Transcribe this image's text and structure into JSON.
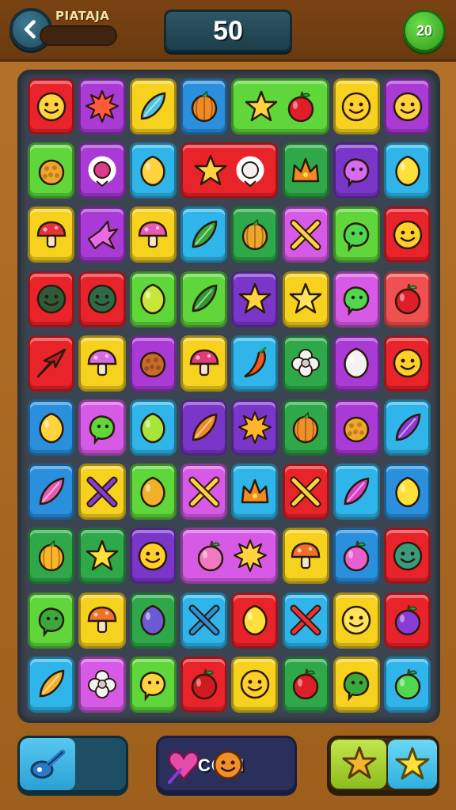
{
  "header": {
    "level_name": "PIATAJA",
    "score": "50",
    "moves": "20"
  },
  "board": {
    "rows": 10,
    "cols": 8,
    "tiles": [
      {
        "r": 0,
        "c": 0,
        "span": 1,
        "color": "#e8232a",
        "icon": "smiley-icon",
        "glyph": "face",
        "gc": "#ffd23f"
      },
      {
        "r": 0,
        "c": 1,
        "span": 1,
        "color": "#a93ad6",
        "icon": "sun-icon",
        "glyph": "sun",
        "gc": "#ff5a3c"
      },
      {
        "r": 0,
        "c": 2,
        "span": 1,
        "color": "#f6d21e",
        "icon": "crystal-icon",
        "glyph": "leaf",
        "gc": "#4fc3e0"
      },
      {
        "r": 0,
        "c": 3,
        "span": 1,
        "color": "#2a8fdd",
        "icon": "pumpkin-icon",
        "glyph": "orange",
        "gc": "#f08a24"
      },
      {
        "r": 0,
        "c": 4,
        "span": 2,
        "color": "#5fd63a",
        "icon": "star-apple-icon",
        "glyph": "starapple",
        "gc": "#ffd23f"
      },
      {
        "r": 0,
        "c": 6,
        "span": 1,
        "color": "#f6d21e",
        "icon": "smiley-icon",
        "glyph": "face",
        "gc": "#ffcf2a"
      },
      {
        "r": 0,
        "c": 7,
        "span": 1,
        "color": "#a93ad6",
        "icon": "smiley-icon",
        "glyph": "face",
        "gc": "#ffd23f"
      },
      {
        "r": 1,
        "c": 0,
        "span": 1,
        "color": "#5fd63a",
        "icon": "pineapple-icon",
        "glyph": "berry",
        "gc": "#f0a62a"
      },
      {
        "r": 1,
        "c": 1,
        "span": 1,
        "color": "#a93ad6",
        "icon": "candy-icon",
        "glyph": "ring",
        "gc": "#e03a8a"
      },
      {
        "r": 1,
        "c": 2,
        "span": 1,
        "color": "#2fb5ea",
        "icon": "lemon-icon",
        "glyph": "lemon",
        "gc": "#ffd23f"
      },
      {
        "r": 1,
        "c": 3,
        "span": 2,
        "color": "#e8232a",
        "icon": "star-lollipop-icon",
        "glyph": "starlolly",
        "gc": "#ffd23f"
      },
      {
        "r": 1,
        "c": 5,
        "span": 1,
        "color": "#2fa84a",
        "icon": "crown-icon",
        "glyph": "crown",
        "gc": "#f08a24"
      },
      {
        "r": 1,
        "c": 6,
        "span": 1,
        "color": "#7a36c8",
        "icon": "blob-icon",
        "glyph": "blob",
        "gc": "#d66af0"
      },
      {
        "r": 1,
        "c": 7,
        "span": 1,
        "color": "#2fb5ea",
        "icon": "lemon-icon",
        "glyph": "lemon",
        "gc": "#ffe03a"
      },
      {
        "r": 2,
        "c": 0,
        "span": 1,
        "color": "#f6d21e",
        "icon": "mushroom-icon",
        "glyph": "mushroom",
        "gc": "#e8323a"
      },
      {
        "r": 2,
        "c": 1,
        "span": 1,
        "color": "#a93ad6",
        "icon": "bird-icon",
        "glyph": "bird",
        "gc": "#e86ae8"
      },
      {
        "r": 2,
        "c": 2,
        "span": 1,
        "color": "#f6d21e",
        "icon": "mushroom-icon",
        "glyph": "mushroom",
        "gc": "#e85ab0"
      },
      {
        "r": 2,
        "c": 3,
        "span": 1,
        "color": "#2fb5ea",
        "icon": "pepper-icon",
        "glyph": "leaf",
        "gc": "#3aa83a"
      },
      {
        "r": 2,
        "c": 4,
        "span": 1,
        "color": "#2fa84a",
        "icon": "onion-icon",
        "glyph": "orange",
        "gc": "#f0a62a"
      },
      {
        "r": 2,
        "c": 5,
        "span": 1,
        "color": "#d65ae6",
        "icon": "sword-icon",
        "glyph": "cross",
        "gc": "#ffd23f"
      },
      {
        "r": 2,
        "c": 6,
        "span": 1,
        "color": "#5fd63a",
        "icon": "blob-icon",
        "glyph": "blob",
        "gc": "#4fd84f"
      },
      {
        "r": 2,
        "c": 7,
        "span": 1,
        "color": "#e8232a",
        "icon": "smiley-icon",
        "glyph": "face",
        "gc": "#ffcf2a"
      },
      {
        "r": 3,
        "c": 0,
        "span": 1,
        "color": "#e8232a",
        "icon": "face-icon",
        "glyph": "face",
        "gc": "#2f5a3a"
      },
      {
        "r": 3,
        "c": 1,
        "span": 1,
        "color": "#e8232a",
        "icon": "face-icon",
        "glyph": "face",
        "gc": "#2f6a48"
      },
      {
        "r": 3,
        "c": 2,
        "span": 1,
        "color": "#5fd63a",
        "icon": "pear-icon",
        "glyph": "lemon",
        "gc": "#c8e63a"
      },
      {
        "r": 3,
        "c": 3,
        "span": 1,
        "color": "#5fd63a",
        "icon": "cucumber-icon",
        "glyph": "leaf",
        "gc": "#2f9a2f"
      },
      {
        "r": 3,
        "c": 4,
        "span": 1,
        "color": "#7a36c8",
        "icon": "star-icon",
        "glyph": "star",
        "gc": "#ffd23f"
      },
      {
        "r": 3,
        "c": 5,
        "span": 1,
        "color": "#f6d21e",
        "icon": "star-icon",
        "glyph": "star",
        "gc": "#ffe35a"
      },
      {
        "r": 3,
        "c": 6,
        "span": 1,
        "color": "#d65ae6",
        "icon": "blob-icon",
        "glyph": "blob",
        "gc": "#4fd84f"
      },
      {
        "r": 3,
        "c": 7,
        "span": 1,
        "color": "#f05050",
        "icon": "apple-icon",
        "glyph": "apple",
        "gc": "#e01e2a"
      },
      {
        "r": 4,
        "c": 0,
        "span": 1,
        "color": "#e8232a",
        "icon": "leaf-icon",
        "glyph": "arrow",
        "gc": "#c81a22"
      },
      {
        "r": 4,
        "c": 1,
        "span": 1,
        "color": "#f6d21e",
        "icon": "mushroom-icon",
        "glyph": "mushroom",
        "gc": "#d66ae6"
      },
      {
        "r": 4,
        "c": 2,
        "span": 1,
        "color": "#a93ad6",
        "icon": "pretzel-icon",
        "glyph": "berry",
        "gc": "#c86a2a"
      },
      {
        "r": 4,
        "c": 3,
        "span": 1,
        "color": "#f6d21e",
        "icon": "mushroom-icon",
        "glyph": "mushroom",
        "gc": "#e03a7a"
      },
      {
        "r": 4,
        "c": 4,
        "span": 1,
        "color": "#2fb5ea",
        "icon": "pepper-icon",
        "glyph": "chili",
        "gc": "#f05a1e"
      },
      {
        "r": 4,
        "c": 5,
        "span": 1,
        "color": "#2fa84a",
        "icon": "flower-icon",
        "glyph": "flower",
        "gc": "#f2f2f2"
      },
      {
        "r": 4,
        "c": 6,
        "span": 1,
        "color": "#a93ad6",
        "icon": "garlic-icon",
        "glyph": "lemon",
        "gc": "#f2f2f2"
      },
      {
        "r": 4,
        "c": 7,
        "span": 1,
        "color": "#e8232a",
        "icon": "smiley-icon",
        "glyph": "face",
        "gc": "#ffcf2a"
      },
      {
        "r": 5,
        "c": 0,
        "span": 1,
        "color": "#2a8fdd",
        "icon": "lemon-icon",
        "glyph": "lemon",
        "gc": "#ffd23f"
      },
      {
        "r": 5,
        "c": 1,
        "span": 1,
        "color": "#d65ae6",
        "icon": "blob-icon",
        "glyph": "blob",
        "gc": "#5fd63a"
      },
      {
        "r": 5,
        "c": 2,
        "span": 1,
        "color": "#2fb5ea",
        "icon": "lime-icon",
        "glyph": "lemon",
        "gc": "#a6e63a"
      },
      {
        "r": 5,
        "c": 3,
        "span": 1,
        "color": "#7a36c8",
        "icon": "carrot-icon",
        "glyph": "leaf",
        "gc": "#f08a24"
      },
      {
        "r": 5,
        "c": 4,
        "span": 1,
        "color": "#7a36c8",
        "icon": "sun-icon",
        "glyph": "sun",
        "gc": "#ffb52a"
      },
      {
        "r": 5,
        "c": 5,
        "span": 1,
        "color": "#2fa84a",
        "icon": "orange-icon",
        "glyph": "orange",
        "gc": "#f0902a"
      },
      {
        "r": 5,
        "c": 6,
        "span": 1,
        "color": "#a93ad6",
        "icon": "berry-icon",
        "glyph": "berry",
        "gc": "#f0a62a"
      },
      {
        "r": 5,
        "c": 7,
        "span": 1,
        "color": "#2fb5ea",
        "icon": "eggplant-icon",
        "glyph": "leaf",
        "gc": "#8a3ad6"
      },
      {
        "r": 6,
        "c": 0,
        "span": 1,
        "color": "#2a8fdd",
        "icon": "radish-icon",
        "glyph": "leaf",
        "gc": "#e85ab0"
      },
      {
        "r": 6,
        "c": 1,
        "span": 1,
        "color": "#f6d21e",
        "icon": "sword-icon",
        "glyph": "cross",
        "gc": "#8a3ad6"
      },
      {
        "r": 6,
        "c": 2,
        "span": 1,
        "color": "#5fd63a",
        "icon": "mango-icon",
        "glyph": "lemon",
        "gc": "#f0b02a"
      },
      {
        "r": 6,
        "c": 3,
        "span": 1,
        "color": "#d65ae6",
        "icon": "sword-icon",
        "glyph": "cross",
        "gc": "#ffd23f"
      },
      {
        "r": 6,
        "c": 4,
        "span": 1,
        "color": "#2fb5ea",
        "icon": "crown-icon",
        "glyph": "crown",
        "gc": "#f08a24"
      },
      {
        "r": 6,
        "c": 5,
        "span": 1,
        "color": "#e8232a",
        "icon": "sword-icon",
        "glyph": "cross",
        "gc": "#ffd23f"
      },
      {
        "r": 6,
        "c": 6,
        "span": 1,
        "color": "#2fb5ea",
        "icon": "eggplant-icon",
        "glyph": "leaf",
        "gc": "#d640c0"
      },
      {
        "r": 6,
        "c": 7,
        "span": 1,
        "color": "#2a8fdd",
        "icon": "lemon-icon",
        "glyph": "lemon",
        "gc": "#ffe03a"
      },
      {
        "r": 7,
        "c": 0,
        "span": 1,
        "color": "#2fa84a",
        "icon": "orange-icon",
        "glyph": "orange",
        "gc": "#ffb52a"
      },
      {
        "r": 7,
        "c": 1,
        "span": 1,
        "color": "#2fa84a",
        "icon": "star-icon",
        "glyph": "star",
        "gc": "#ffe03a"
      },
      {
        "r": 7,
        "c": 2,
        "span": 1,
        "color": "#7a36c8",
        "icon": "smiley-icon",
        "glyph": "face",
        "gc": "#ffcf2a"
      },
      {
        "r": 7,
        "c": 3,
        "span": 2,
        "color": "#d65ae6",
        "icon": "heart-sun-icon",
        "glyph": "heartsun",
        "gc": "#ffd23f"
      },
      {
        "r": 7,
        "c": 5,
        "span": 1,
        "color": "#f6d21e",
        "icon": "mushroom-icon",
        "glyph": "mushroom",
        "gc": "#f0702a"
      },
      {
        "r": 7,
        "c": 6,
        "span": 1,
        "color": "#2a8fdd",
        "icon": "plum-icon",
        "glyph": "apple",
        "gc": "#e860d0"
      },
      {
        "r": 7,
        "c": 7,
        "span": 1,
        "color": "#e8232a",
        "icon": "face-icon",
        "glyph": "face",
        "gc": "#3a9a7a"
      },
      {
        "r": 8,
        "c": 0,
        "span": 1,
        "color": "#5fd63a",
        "icon": "blob-icon",
        "glyph": "blob",
        "gc": "#3aa83a"
      },
      {
        "r": 8,
        "c": 1,
        "span": 1,
        "color": "#f6d21e",
        "icon": "mushroom-icon",
        "glyph": "mushroom",
        "gc": "#f0702a"
      },
      {
        "r": 8,
        "c": 2,
        "span": 1,
        "color": "#2fa84a",
        "icon": "grape-icon",
        "glyph": "lemon",
        "gc": "#6a5ad6"
      },
      {
        "r": 8,
        "c": 3,
        "span": 1,
        "color": "#2fb5ea",
        "icon": "sword-icon",
        "glyph": "cross",
        "gc": "#2a8fdd"
      },
      {
        "r": 8,
        "c": 4,
        "span": 1,
        "color": "#e8232a",
        "icon": "lemon-icon",
        "glyph": "lemon",
        "gc": "#ffe03a"
      },
      {
        "r": 8,
        "c": 5,
        "span": 1,
        "color": "#2fb5ea",
        "icon": "sword-icon",
        "glyph": "cross",
        "gc": "#e8323a"
      },
      {
        "r": 8,
        "c": 6,
        "span": 1,
        "color": "#f6d21e",
        "icon": "blob-icon",
        "glyph": "face",
        "gc": "#ffe35a"
      },
      {
        "r": 8,
        "c": 7,
        "span": 1,
        "color": "#e8232a",
        "icon": "plum-icon",
        "glyph": "apple",
        "gc": "#8a3ad6"
      },
      {
        "r": 9,
        "c": 0,
        "span": 1,
        "color": "#2fb5ea",
        "icon": "squash-icon",
        "glyph": "leaf",
        "gc": "#f0b02a"
      },
      {
        "r": 9,
        "c": 1,
        "span": 1,
        "color": "#d65ae6",
        "icon": "flower-icon",
        "glyph": "flower",
        "gc": "#f2f2f2"
      },
      {
        "r": 9,
        "c": 2,
        "span": 1,
        "color": "#5fd63a",
        "icon": "blob-icon",
        "glyph": "blob",
        "gc": "#ffd23f"
      },
      {
        "r": 9,
        "c": 3,
        "span": 1,
        "color": "#e8232a",
        "icon": "apple-icon",
        "glyph": "apple",
        "gc": "#d01a22"
      },
      {
        "r": 9,
        "c": 4,
        "span": 1,
        "color": "#f6d21e",
        "icon": "smiley-icon",
        "glyph": "face",
        "gc": "#ffcf2a"
      },
      {
        "r": 9,
        "c": 5,
        "span": 1,
        "color": "#2fa84a",
        "icon": "apple-icon",
        "glyph": "apple",
        "gc": "#e01e2a"
      },
      {
        "r": 9,
        "c": 6,
        "span": 1,
        "color": "#f6d21e",
        "icon": "blob-icon",
        "glyph": "blob",
        "gc": "#3aa83a"
      },
      {
        "r": 9,
        "c": 7,
        "span": 1,
        "color": "#2fb5ea",
        "icon": "lime-icon",
        "glyph": "apple",
        "gc": "#4fd84f"
      }
    ]
  },
  "footer": {
    "left_booster_icon": "spoon-icon",
    "combo_label": "COKI",
    "combo_icons": [
      "heart-icon",
      "smiley-icon"
    ],
    "right_booster_icons": [
      "star-burst-icon",
      "star-icon"
    ]
  },
  "colors": {
    "background": "#a8661f",
    "board": "#3b4552",
    "score_box": "#1d3d49",
    "moves_badge": "#2f9a1c"
  }
}
